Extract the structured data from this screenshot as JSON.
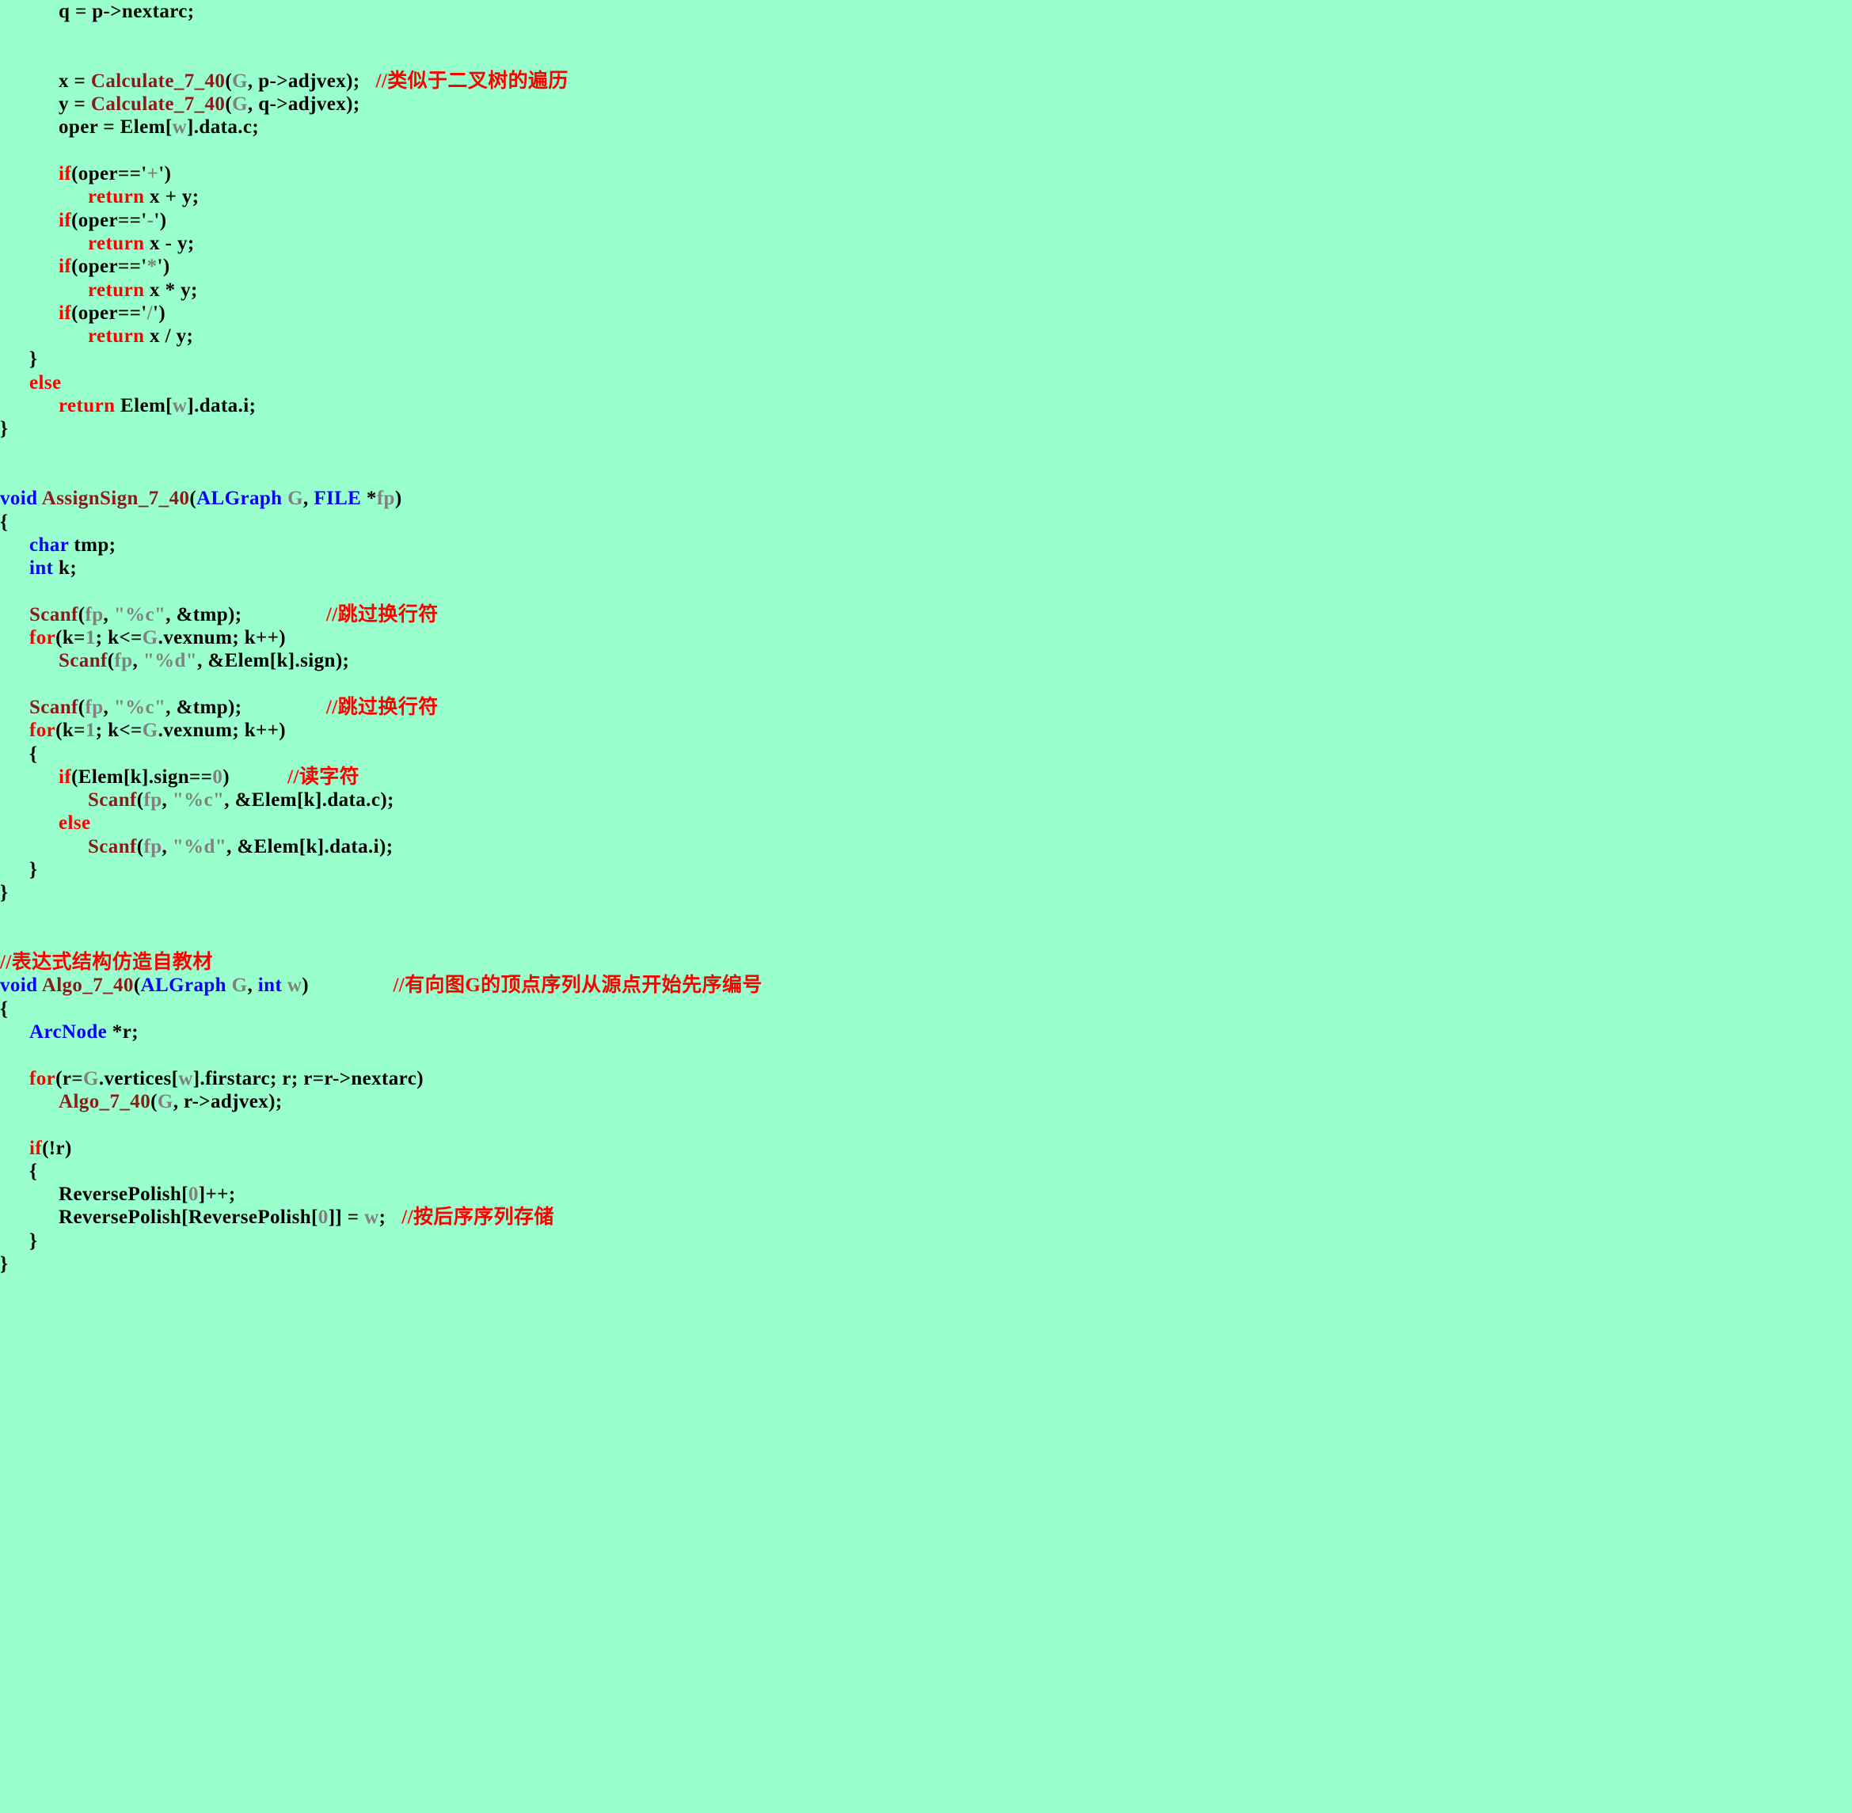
{
  "document": {
    "background_color": "#99ffcc",
    "title": "C source code listing - expression evaluation on adjacency-list graph",
    "colors": {
      "text": "#000000",
      "keyword": "#ff0000",
      "type": "#0000ff",
      "function": "#8b1a1a",
      "gray_literal": "#808080",
      "comment": "#ff0000",
      "background": "#99ffcc"
    }
  },
  "code": {
    "lines": [
      {
        "indent": 2,
        "tokens": [
          {
            "t": "q = p->nextarc;",
            "c": "pun"
          }
        ]
      },
      {
        "indent": 0,
        "tokens": []
      },
      {
        "indent": 0,
        "tokens": []
      },
      {
        "indent": 2,
        "tokens": [
          {
            "t": "x = ",
            "c": "pun"
          },
          {
            "t": "Calculate_7_40",
            "c": "fn"
          },
          {
            "t": "(",
            "c": "pun"
          },
          {
            "t": "G",
            "c": "var"
          },
          {
            "t": ", p->adjvex);",
            "c": "pun"
          },
          {
            "t": "   ",
            "c": "pun"
          },
          {
            "t": "//类似于二叉树的遍历",
            "c": "cmt"
          }
        ]
      },
      {
        "indent": 2,
        "tokens": [
          {
            "t": "y = ",
            "c": "pun"
          },
          {
            "t": "Calculate_7_40",
            "c": "fn"
          },
          {
            "t": "(",
            "c": "pun"
          },
          {
            "t": "G",
            "c": "var"
          },
          {
            "t": ", q->adjvex);",
            "c": "pun"
          }
        ]
      },
      {
        "indent": 2,
        "tokens": [
          {
            "t": "oper = Elem[",
            "c": "pun"
          },
          {
            "t": "w",
            "c": "var"
          },
          {
            "t": "].data.c;",
            "c": "pun"
          }
        ]
      },
      {
        "indent": 0,
        "tokens": []
      },
      {
        "indent": 2,
        "tokens": [
          {
            "t": "if",
            "c": "kw"
          },
          {
            "t": "(oper=='",
            "c": "pun"
          },
          {
            "t": "+",
            "c": "var"
          },
          {
            "t": "')",
            "c": "pun"
          }
        ]
      },
      {
        "indent": 3,
        "tokens": [
          {
            "t": "return",
            "c": "kw"
          },
          {
            "t": " x + y;",
            "c": "pun"
          }
        ]
      },
      {
        "indent": 2,
        "tokens": [
          {
            "t": "if",
            "c": "kw"
          },
          {
            "t": "(oper=='",
            "c": "pun"
          },
          {
            "t": "-",
            "c": "var"
          },
          {
            "t": "')",
            "c": "pun"
          }
        ]
      },
      {
        "indent": 3,
        "tokens": [
          {
            "t": "return",
            "c": "kw"
          },
          {
            "t": " x - y;",
            "c": "pun"
          }
        ]
      },
      {
        "indent": 2,
        "tokens": [
          {
            "t": "if",
            "c": "kw"
          },
          {
            "t": "(oper=='",
            "c": "pun"
          },
          {
            "t": "*",
            "c": "var"
          },
          {
            "t": "')",
            "c": "pun"
          }
        ]
      },
      {
        "indent": 3,
        "tokens": [
          {
            "t": "return",
            "c": "kw"
          },
          {
            "t": " x * y;",
            "c": "pun"
          }
        ]
      },
      {
        "indent": 2,
        "tokens": [
          {
            "t": "if",
            "c": "kw"
          },
          {
            "t": "(oper=='",
            "c": "pun"
          },
          {
            "t": "/",
            "c": "var"
          },
          {
            "t": "')",
            "c": "pun"
          }
        ]
      },
      {
        "indent": 3,
        "tokens": [
          {
            "t": "return",
            "c": "kw"
          },
          {
            "t": " x / y;",
            "c": "pun"
          }
        ]
      },
      {
        "indent": 1,
        "tokens": [
          {
            "t": "}",
            "c": "pun"
          }
        ]
      },
      {
        "indent": 1,
        "tokens": [
          {
            "t": "else",
            "c": "kw"
          }
        ]
      },
      {
        "indent": 2,
        "tokens": [
          {
            "t": "return",
            "c": "kw"
          },
          {
            "t": " Elem[",
            "c": "pun"
          },
          {
            "t": "w",
            "c": "var"
          },
          {
            "t": "].data.i;",
            "c": "pun"
          }
        ]
      },
      {
        "indent": 0,
        "tokens": [
          {
            "t": "}",
            "c": "pun"
          }
        ]
      },
      {
        "indent": 0,
        "tokens": []
      },
      {
        "indent": 0,
        "tokens": []
      },
      {
        "indent": 0,
        "tokens": [
          {
            "t": "void",
            "c": "typ"
          },
          {
            "t": " ",
            "c": "pun"
          },
          {
            "t": "AssignSign_7_40",
            "c": "fn"
          },
          {
            "t": "(",
            "c": "pun"
          },
          {
            "t": "ALGraph",
            "c": "typ"
          },
          {
            "t": " ",
            "c": "pun"
          },
          {
            "t": "G",
            "c": "var"
          },
          {
            "t": ", ",
            "c": "pun"
          },
          {
            "t": "FILE",
            "c": "typ"
          },
          {
            "t": " *",
            "c": "pun"
          },
          {
            "t": "fp",
            "c": "var"
          },
          {
            "t": ")",
            "c": "pun"
          }
        ]
      },
      {
        "indent": 0,
        "tokens": [
          {
            "t": "{",
            "c": "pun"
          }
        ]
      },
      {
        "indent": 1,
        "tokens": [
          {
            "t": "char",
            "c": "typ"
          },
          {
            "t": " tmp;",
            "c": "pun"
          }
        ]
      },
      {
        "indent": 1,
        "tokens": [
          {
            "t": "int",
            "c": "typ"
          },
          {
            "t": " k;",
            "c": "pun"
          }
        ]
      },
      {
        "indent": 0,
        "tokens": []
      },
      {
        "indent": 1,
        "tokens": [
          {
            "t": "Scanf",
            "c": "fn"
          },
          {
            "t": "(",
            "c": "pun"
          },
          {
            "t": "fp",
            "c": "var"
          },
          {
            "t": ", ",
            "c": "pun"
          },
          {
            "t": "\"%c\"",
            "c": "var"
          },
          {
            "t": ", &tmp);",
            "c": "pun"
          },
          {
            "t": "                ",
            "c": "pun"
          },
          {
            "t": "//跳过换行符",
            "c": "cmt"
          }
        ]
      },
      {
        "indent": 1,
        "tokens": [
          {
            "t": "for",
            "c": "kw"
          },
          {
            "t": "(k=",
            "c": "pun"
          },
          {
            "t": "1",
            "c": "var"
          },
          {
            "t": "; k<=",
            "c": "pun"
          },
          {
            "t": "G",
            "c": "var"
          },
          {
            "t": ".vexnum; k++)",
            "c": "pun"
          }
        ]
      },
      {
        "indent": 2,
        "tokens": [
          {
            "t": "Scanf",
            "c": "fn"
          },
          {
            "t": "(",
            "c": "pun"
          },
          {
            "t": "fp",
            "c": "var"
          },
          {
            "t": ", ",
            "c": "pun"
          },
          {
            "t": "\"%d\"",
            "c": "var"
          },
          {
            "t": ", &Elem[k].sign);",
            "c": "pun"
          }
        ]
      },
      {
        "indent": 0,
        "tokens": []
      },
      {
        "indent": 1,
        "tokens": [
          {
            "t": "Scanf",
            "c": "fn"
          },
          {
            "t": "(",
            "c": "pun"
          },
          {
            "t": "fp",
            "c": "var"
          },
          {
            "t": ", ",
            "c": "pun"
          },
          {
            "t": "\"%c\"",
            "c": "var"
          },
          {
            "t": ", &tmp);",
            "c": "pun"
          },
          {
            "t": "                ",
            "c": "pun"
          },
          {
            "t": "//跳过换行符",
            "c": "cmt"
          }
        ]
      },
      {
        "indent": 1,
        "tokens": [
          {
            "t": "for",
            "c": "kw"
          },
          {
            "t": "(k=",
            "c": "pun"
          },
          {
            "t": "1",
            "c": "var"
          },
          {
            "t": "; k<=",
            "c": "pun"
          },
          {
            "t": "G",
            "c": "var"
          },
          {
            "t": ".vexnum; k++)",
            "c": "pun"
          }
        ]
      },
      {
        "indent": 1,
        "tokens": [
          {
            "t": "{",
            "c": "pun"
          }
        ]
      },
      {
        "indent": 2,
        "tokens": [
          {
            "t": "if",
            "c": "kw"
          },
          {
            "t": "(Elem[k].sign==",
            "c": "pun"
          },
          {
            "t": "0",
            "c": "var"
          },
          {
            "t": ")",
            "c": "pun"
          },
          {
            "t": "           ",
            "c": "pun"
          },
          {
            "t": "//读字符",
            "c": "cmt"
          }
        ]
      },
      {
        "indent": 3,
        "tokens": [
          {
            "t": "Scanf",
            "c": "fn"
          },
          {
            "t": "(",
            "c": "pun"
          },
          {
            "t": "fp",
            "c": "var"
          },
          {
            "t": ", ",
            "c": "pun"
          },
          {
            "t": "\"%c\"",
            "c": "var"
          },
          {
            "t": ", &Elem[k].data.c);",
            "c": "pun"
          }
        ]
      },
      {
        "indent": 2,
        "tokens": [
          {
            "t": "else",
            "c": "kw"
          }
        ]
      },
      {
        "indent": 3,
        "tokens": [
          {
            "t": "Scanf",
            "c": "fn"
          },
          {
            "t": "(",
            "c": "pun"
          },
          {
            "t": "fp",
            "c": "var"
          },
          {
            "t": ", ",
            "c": "pun"
          },
          {
            "t": "\"%d\"",
            "c": "var"
          },
          {
            "t": ", &Elem[k].data.i);",
            "c": "pun"
          }
        ]
      },
      {
        "indent": 1,
        "tokens": [
          {
            "t": "}",
            "c": "pun"
          }
        ]
      },
      {
        "indent": 0,
        "tokens": [
          {
            "t": "}",
            "c": "pun"
          }
        ]
      },
      {
        "indent": 0,
        "tokens": []
      },
      {
        "indent": 0,
        "tokens": []
      },
      {
        "indent": 0,
        "tokens": [
          {
            "t": "//表达式结构仿造自教材",
            "c": "cmt"
          }
        ]
      },
      {
        "indent": 0,
        "tokens": [
          {
            "t": "void",
            "c": "typ"
          },
          {
            "t": " ",
            "c": "pun"
          },
          {
            "t": "Algo_7_40",
            "c": "fn"
          },
          {
            "t": "(",
            "c": "pun"
          },
          {
            "t": "ALGraph",
            "c": "typ"
          },
          {
            "t": " ",
            "c": "pun"
          },
          {
            "t": "G",
            "c": "var"
          },
          {
            "t": ", ",
            "c": "pun"
          },
          {
            "t": "int",
            "c": "typ"
          },
          {
            "t": " ",
            "c": "pun"
          },
          {
            "t": "w",
            "c": "var"
          },
          {
            "t": ")",
            "c": "pun"
          },
          {
            "t": "                ",
            "c": "pun"
          },
          {
            "t": "//有向图G的顶点序列从源点开始先序编号",
            "c": "cmt"
          }
        ]
      },
      {
        "indent": 0,
        "tokens": [
          {
            "t": "{",
            "c": "pun"
          }
        ]
      },
      {
        "indent": 1,
        "tokens": [
          {
            "t": "ArcNode",
            "c": "typ"
          },
          {
            "t": " *r;",
            "c": "pun"
          }
        ]
      },
      {
        "indent": 0,
        "tokens": []
      },
      {
        "indent": 1,
        "tokens": [
          {
            "t": "for",
            "c": "kw"
          },
          {
            "t": "(r=",
            "c": "pun"
          },
          {
            "t": "G",
            "c": "var"
          },
          {
            "t": ".vertices[",
            "c": "pun"
          },
          {
            "t": "w",
            "c": "var"
          },
          {
            "t": "].firstarc; r; r=r->nextarc)",
            "c": "pun"
          }
        ]
      },
      {
        "indent": 2,
        "tokens": [
          {
            "t": "Algo_7_40",
            "c": "fn"
          },
          {
            "t": "(",
            "c": "pun"
          },
          {
            "t": "G",
            "c": "var"
          },
          {
            "t": ", r->adjvex);",
            "c": "pun"
          }
        ]
      },
      {
        "indent": 0,
        "tokens": []
      },
      {
        "indent": 1,
        "tokens": [
          {
            "t": "if",
            "c": "kw"
          },
          {
            "t": "(!r)",
            "c": "pun"
          }
        ]
      },
      {
        "indent": 1,
        "tokens": [
          {
            "t": "{",
            "c": "pun"
          }
        ]
      },
      {
        "indent": 2,
        "tokens": [
          {
            "t": "ReversePolish[",
            "c": "pun"
          },
          {
            "t": "0",
            "c": "var"
          },
          {
            "t": "]++;",
            "c": "pun"
          }
        ]
      },
      {
        "indent": 2,
        "tokens": [
          {
            "t": "ReversePolish[ReversePolish[",
            "c": "pun"
          },
          {
            "t": "0",
            "c": "var"
          },
          {
            "t": "]] = ",
            "c": "pun"
          },
          {
            "t": "w",
            "c": "var"
          },
          {
            "t": ";",
            "c": "pun"
          },
          {
            "t": "   ",
            "c": "pun"
          },
          {
            "t": "//按后序序列存储",
            "c": "cmt"
          }
        ]
      },
      {
        "indent": 1,
        "tokens": [
          {
            "t": "}",
            "c": "pun"
          }
        ]
      },
      {
        "indent": 0,
        "tokens": [
          {
            "t": "}",
            "c": "pun"
          }
        ]
      }
    ]
  }
}
